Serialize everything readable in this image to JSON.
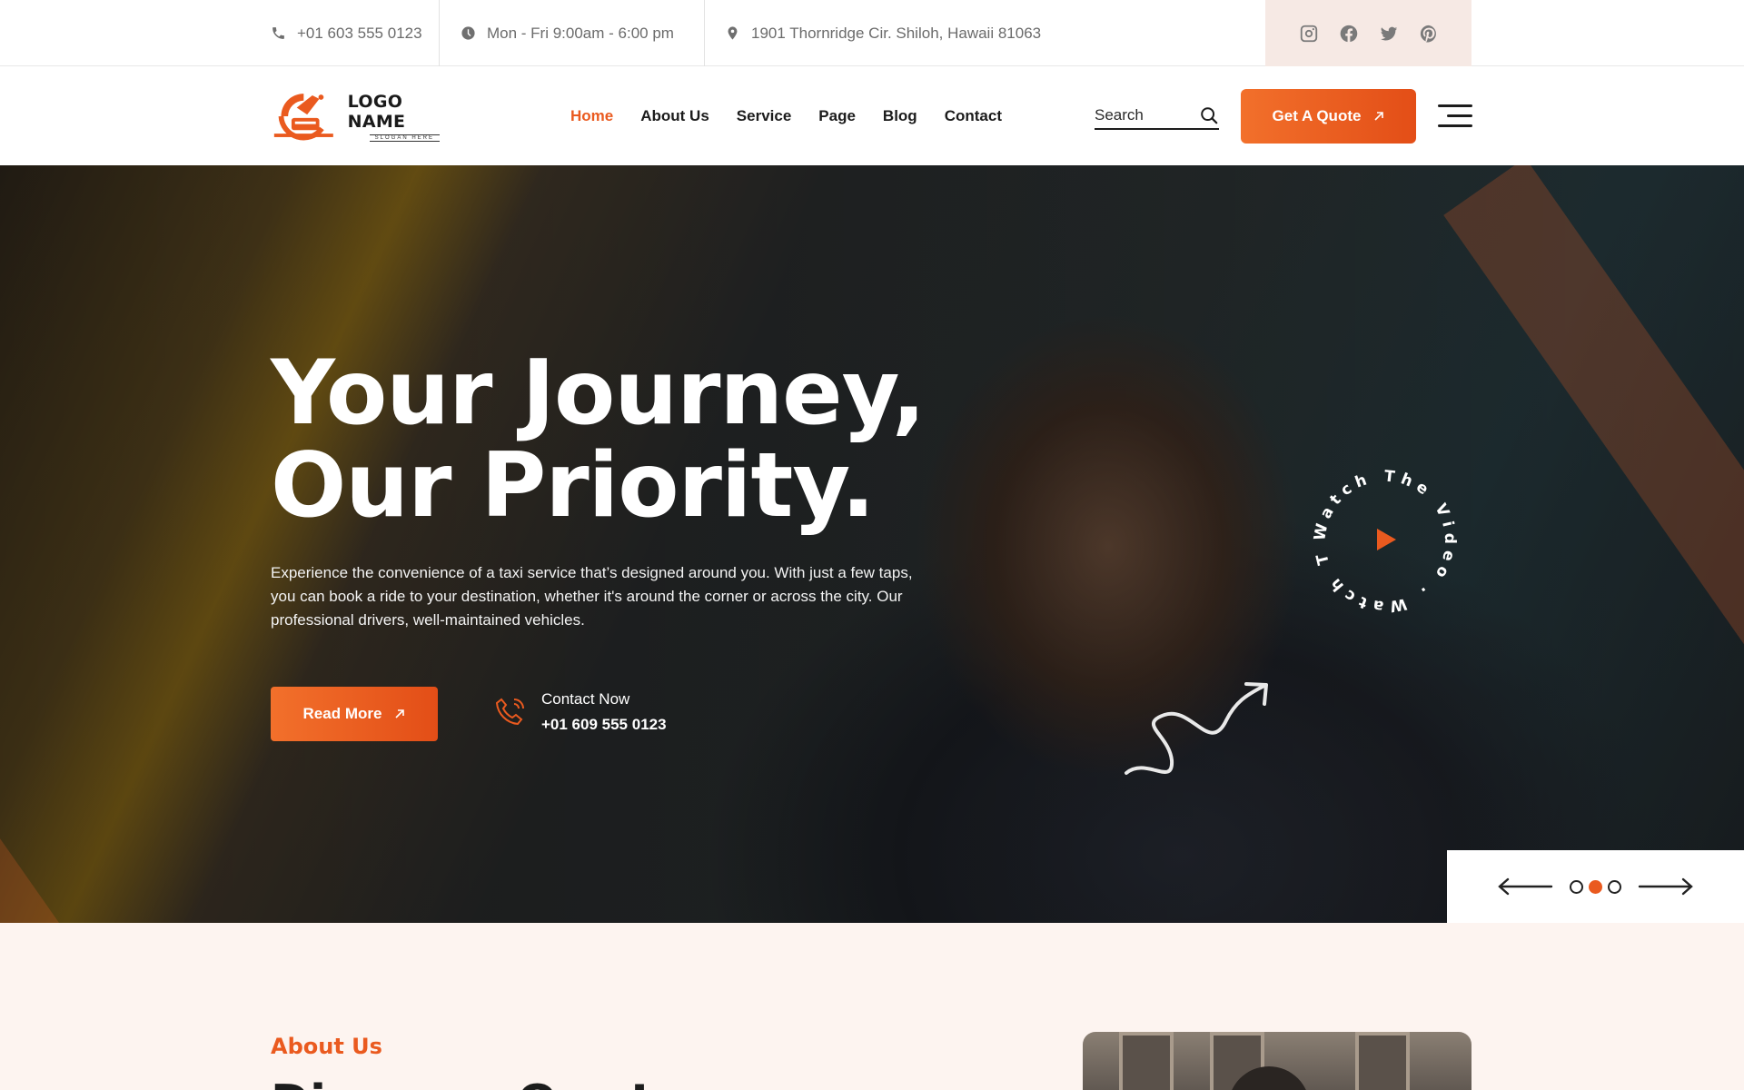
{
  "topbar": {
    "phone": "+01 603 555 0123",
    "hours": "Mon - Fri 9:00am - 6:00 pm",
    "address": "1901 Thornridge Cir. Shiloh, Hawaii 81063",
    "social": [
      "instagram-icon",
      "facebook-icon",
      "twitter-icon",
      "pinterest-icon"
    ]
  },
  "logo": {
    "name": "LOGO NAME",
    "slogan": "SLOGAN HERE"
  },
  "nav": {
    "items": [
      "Home",
      "About Us",
      "Service",
      "Page",
      "Blog",
      "Contact"
    ],
    "active": "Home"
  },
  "search": {
    "placeholder": "Search"
  },
  "quote_button": "Get A Quote",
  "hero": {
    "title_line1": "Your Journey,",
    "title_line2": "Our Priority.",
    "description": "Experience the convenience of a taxi service that’s designed around you. With just a few taps, you can book a ride to your destination, whether it's around the corner or across the city. Our professional drivers, well-maintained vehicles.",
    "read_more": "Read More",
    "contact_label": "Contact Now",
    "contact_number": "+01 609 555 0123",
    "video_text": "Watch The Video . Watch The Video ."
  },
  "slider": {
    "dots": 3,
    "active_dot": 1
  },
  "about": {
    "label": "About Us",
    "title": "Discover Our Journey"
  },
  "colors": {
    "accent": "#ea5a1f",
    "accent_light": "#f2702b",
    "text": "#1c1c1c",
    "social_bg": "#f6e9e4",
    "about_bg": "#fdf4f0"
  }
}
